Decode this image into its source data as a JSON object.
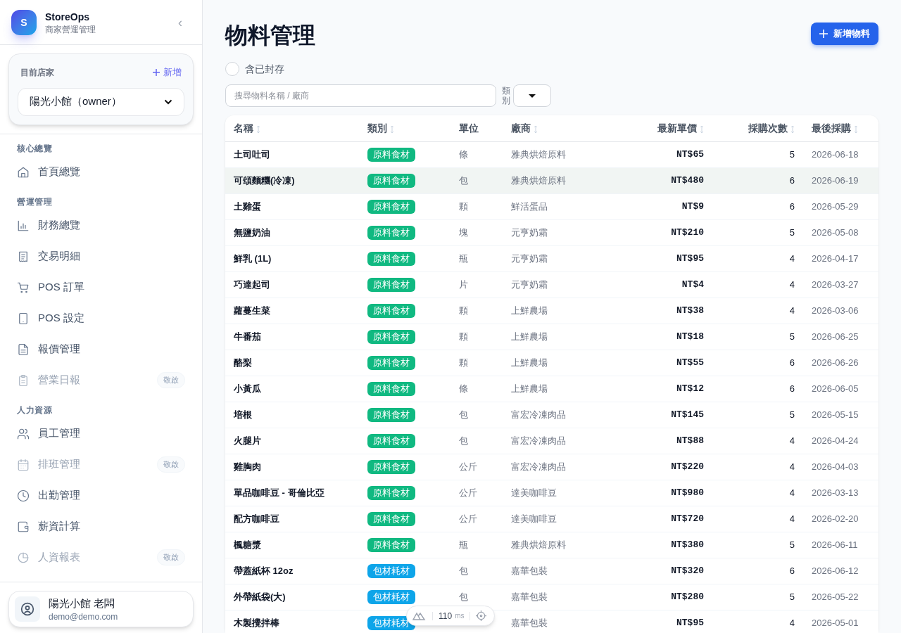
{
  "brand": {
    "logo_letter": "S",
    "name": "StoreOps",
    "subtitle": "商家營運管理",
    "collapse": "‹"
  },
  "store_card": {
    "label": "目前店家",
    "add_label": "新增",
    "selected_store": "陽光小館（owner）"
  },
  "nav_sections": [
    {
      "title": "核心總覽",
      "items": [
        {
          "label": "首頁總覽",
          "disabled": false
        }
      ]
    },
    {
      "title": "營運管理",
      "items": [
        {
          "label": "財務總覽",
          "disabled": false
        },
        {
          "label": "交易明細",
          "disabled": false
        },
        {
          "label": "POS 訂單",
          "disabled": false
        },
        {
          "label": "POS 設定",
          "disabled": false
        },
        {
          "label": "報價管理",
          "disabled": false
        },
        {
          "label": "營業日報",
          "disabled": true,
          "badge": "敬啟"
        }
      ]
    },
    {
      "title": "人力資源",
      "items": [
        {
          "label": "員工管理",
          "disabled": false
        },
        {
          "label": "排班管理",
          "disabled": true,
          "badge": "敬啟"
        },
        {
          "label": "出勤管理",
          "disabled": false
        },
        {
          "label": "薪資計算",
          "disabled": false
        },
        {
          "label": "人資報表",
          "disabled": true,
          "badge": "敬啟"
        }
      ]
    }
  ],
  "user": {
    "name": "陽光小館 老闆",
    "email": "demo@demo.com"
  },
  "page": {
    "title": "物料管理",
    "add_button": "新增物料"
  },
  "filters": {
    "archived_label": "含已封存",
    "archived_checked": false,
    "search_placeholder": "搜尋物料名稱 / 廠商",
    "category_label": "類別"
  },
  "table": {
    "columns": [
      {
        "label": "名稱",
        "sortable": true
      },
      {
        "label": "類別",
        "sortable": true
      },
      {
        "label": "單位",
        "sortable": false
      },
      {
        "label": "廠商",
        "sortable": true
      },
      {
        "label": "最新單價",
        "sortable": true
      },
      {
        "label": "採購次數",
        "sortable": true
      },
      {
        "label": "最後採購",
        "sortable": true
      }
    ],
    "rows": [
      {
        "name": "土司吐司",
        "category": "原料食材",
        "color": "#10b981",
        "unit": "條",
        "vendor": "雅典烘焙原料",
        "price": "NT$65",
        "count": "5",
        "last": "2026-06-18",
        "highlighted": false
      },
      {
        "name": "可頌麵糰(冷凍)",
        "category": "原料食材",
        "color": "#10b981",
        "unit": "包",
        "vendor": "雅典烘焙原料",
        "price": "NT$480",
        "count": "6",
        "last": "2026-06-19",
        "highlighted": true
      },
      {
        "name": "土雞蛋",
        "category": "原料食材",
        "color": "#10b981",
        "unit": "顆",
        "vendor": "鮮活蛋品",
        "price": "NT$9",
        "count": "6",
        "last": "2026-05-29",
        "highlighted": false
      },
      {
        "name": "無鹽奶油",
        "category": "原料食材",
        "color": "#10b981",
        "unit": "塊",
        "vendor": "元亨奶霜",
        "price": "NT$210",
        "count": "5",
        "last": "2026-05-08",
        "highlighted": false
      },
      {
        "name": "鮮乳 (1L)",
        "category": "原料食材",
        "color": "#10b981",
        "unit": "瓶",
        "vendor": "元亨奶霜",
        "price": "NT$95",
        "count": "4",
        "last": "2026-04-17",
        "highlighted": false
      },
      {
        "name": "巧達起司",
        "category": "原料食材",
        "color": "#10b981",
        "unit": "片",
        "vendor": "元亨奶霜",
        "price": "NT$4",
        "count": "4",
        "last": "2026-03-27",
        "highlighted": false
      },
      {
        "name": "蘿蔓生菜",
        "category": "原料食材",
        "color": "#10b981",
        "unit": "顆",
        "vendor": "上鮮農場",
        "price": "NT$38",
        "count": "4",
        "last": "2026-03-06",
        "highlighted": false
      },
      {
        "name": "牛番茄",
        "category": "原料食材",
        "color": "#10b981",
        "unit": "顆",
        "vendor": "上鮮農場",
        "price": "NT$18",
        "count": "5",
        "last": "2026-06-25",
        "highlighted": false
      },
      {
        "name": "酪梨",
        "category": "原料食材",
        "color": "#10b981",
        "unit": "顆",
        "vendor": "上鮮農場",
        "price": "NT$55",
        "count": "6",
        "last": "2026-06-26",
        "highlighted": false
      },
      {
        "name": "小黃瓜",
        "category": "原料食材",
        "color": "#10b981",
        "unit": "條",
        "vendor": "上鮮農場",
        "price": "NT$12",
        "count": "6",
        "last": "2026-06-05",
        "highlighted": false
      },
      {
        "name": "培根",
        "category": "原料食材",
        "color": "#10b981",
        "unit": "包",
        "vendor": "富宏冷凍肉品",
        "price": "NT$145",
        "count": "5",
        "last": "2026-05-15",
        "highlighted": false
      },
      {
        "name": "火腿片",
        "category": "原料食材",
        "color": "#10b981",
        "unit": "包",
        "vendor": "富宏冷凍肉品",
        "price": "NT$88",
        "count": "4",
        "last": "2026-04-24",
        "highlighted": false
      },
      {
        "name": "雞胸肉",
        "category": "原料食材",
        "color": "#10b981",
        "unit": "公斤",
        "vendor": "富宏冷凍肉品",
        "price": "NT$220",
        "count": "4",
        "last": "2026-04-03",
        "highlighted": false
      },
      {
        "name": "單品咖啡豆 - 哥倫比亞",
        "category": "原料食材",
        "color": "#10b981",
        "unit": "公斤",
        "vendor": "達美咖啡豆",
        "price": "NT$980",
        "count": "4",
        "last": "2026-03-13",
        "highlighted": false
      },
      {
        "name": "配方咖啡豆",
        "category": "原料食材",
        "color": "#10b981",
        "unit": "公斤",
        "vendor": "達美咖啡豆",
        "price": "NT$720",
        "count": "4",
        "last": "2026-02-20",
        "highlighted": false
      },
      {
        "name": "楓糖漿",
        "category": "原料食材",
        "color": "#10b981",
        "unit": "瓶",
        "vendor": "雅典烘焙原料",
        "price": "NT$380",
        "count": "5",
        "last": "2026-06-11",
        "highlighted": false
      },
      {
        "name": "帶蓋紙杯 12oz",
        "category": "包材耗材",
        "color": "#0ea5e9",
        "unit": "包",
        "vendor": "嘉華包裝",
        "price": "NT$320",
        "count": "6",
        "last": "2026-06-12",
        "highlighted": false
      },
      {
        "name": "外帶紙袋(大)",
        "category": "包材耗材",
        "color": "#0ea5e9",
        "unit": "包",
        "vendor": "嘉華包裝",
        "price": "NT$280",
        "count": "5",
        "last": "2026-05-22",
        "highlighted": false
      },
      {
        "name": "木製攪拌棒",
        "category": "包材耗材",
        "color": "#0ea5e9",
        "vendor": "嘉華包裝",
        "price": "NT$95",
        "count": "4",
        "last": "2026-05-01",
        "highlighted": false
      }
    ]
  },
  "perf_widget": {
    "value": "110",
    "unit": "ms"
  }
}
